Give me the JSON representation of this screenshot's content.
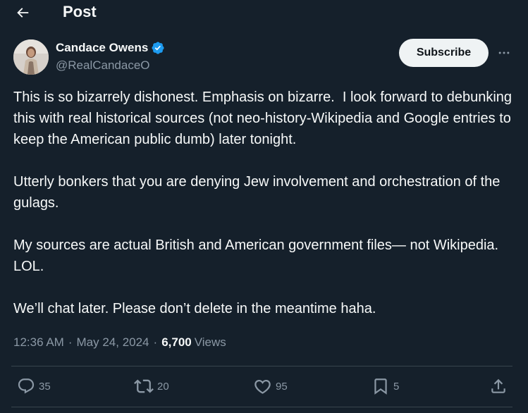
{
  "header": {
    "title": "Post"
  },
  "author": {
    "name": "Candace Owens",
    "handle": "@RealCandaceO",
    "verified": true
  },
  "subscribe_label": "Subscribe",
  "tweet": {
    "paragraphs": [
      "This is so bizarrely dishonest. Emphasis on bizarre.  I look forward to debunking this with real historical sources (not neo-history-Wikipedia and Google entries to keep the American public dumb) later tonight.",
      "Utterly bonkers that you are denying Jew involvement and orchestration of the gulags.",
      "My sources are actual British and American government files— not Wikipedia.  LOL.",
      "We’ll chat later. Please don’t delete in the meantime haha."
    ]
  },
  "meta": {
    "time": "12:36 AM",
    "separator": "·",
    "date": "May 24, 2024",
    "views_count": "6,700",
    "views_label": "Views"
  },
  "actions": {
    "replies": "35",
    "reposts": "20",
    "likes": "95",
    "bookmarks": "5"
  },
  "colors": {
    "background": "#15202b",
    "text": "#f7f9f9",
    "secondary": "#8b98a5",
    "verified": "#1d9bf0",
    "divider": "#38444d"
  },
  "icons": {
    "back": "arrow-left-icon",
    "verified": "verified-badge-icon",
    "more": "more-horizontal-icon",
    "reply": "reply-icon",
    "repost": "repost-icon",
    "like": "heart-icon",
    "bookmark": "bookmark-icon",
    "share": "share-icon"
  }
}
